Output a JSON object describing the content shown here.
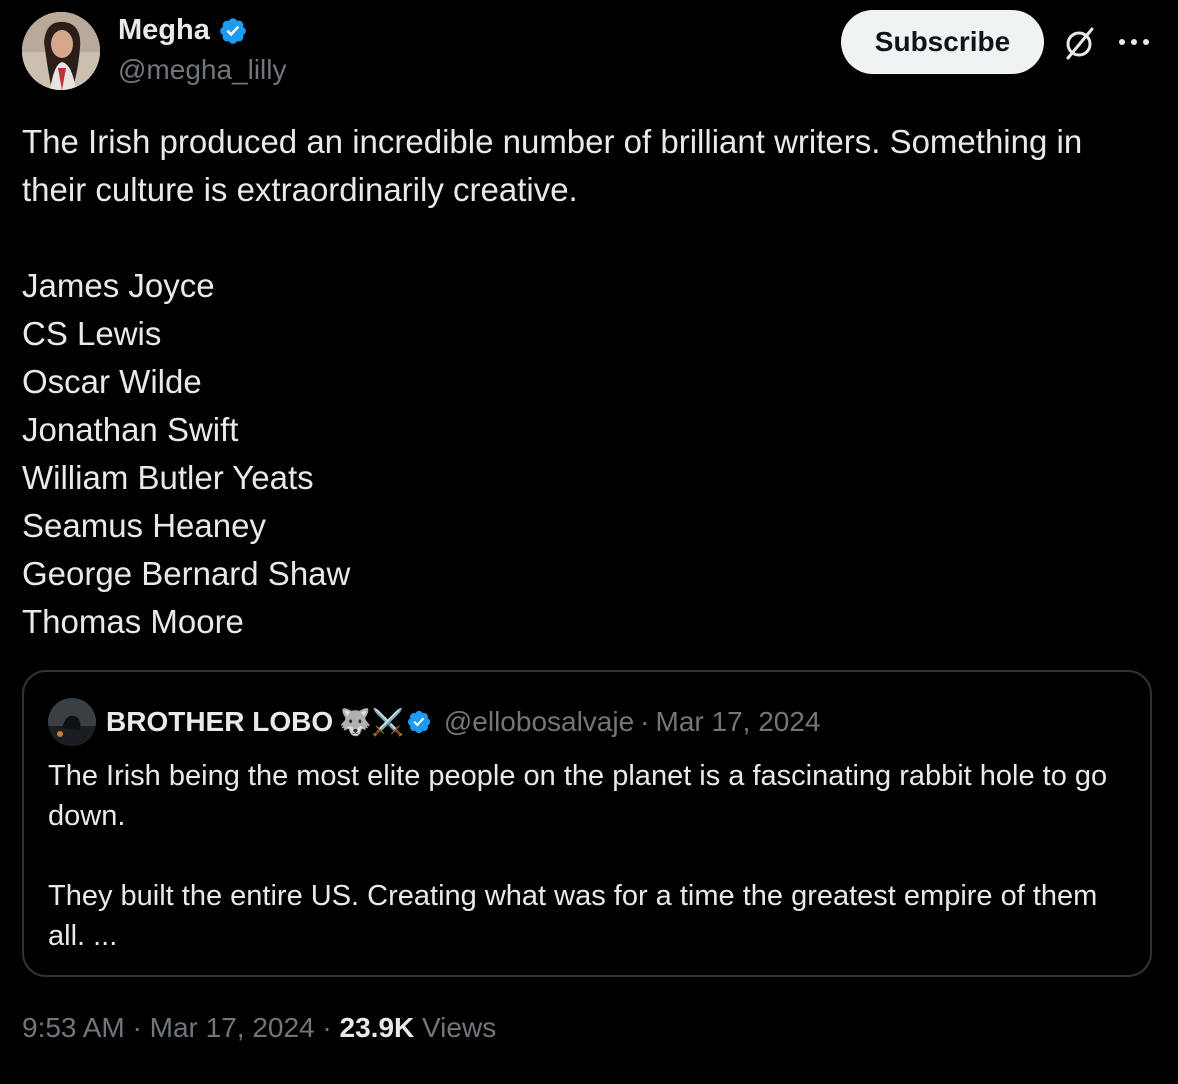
{
  "author": {
    "name": "Megha",
    "handle": "@megha_lilly"
  },
  "actions": {
    "subscribe_label": "Subscribe",
    "grok_icon": "grok-slash-circle-icon",
    "more_icon": "more-dots-icon"
  },
  "tweet": {
    "intro": "The Irish produced an incredible number of brilliant writers. Something in their culture is extraordinarily creative.",
    "writers": [
      "James Joyce",
      "CS Lewis",
      "Oscar Wilde",
      "Jonathan Swift",
      "William Butler Yeats",
      "Seamus Heaney",
      "George Bernard Shaw",
      "Thomas Moore"
    ]
  },
  "quote": {
    "name": "BROTHER LOBO",
    "emojis": "🐺⚔️",
    "handle": "@ellobosalvaje",
    "separator": "·",
    "date": "Mar 17, 2024",
    "paragraph1": "The Irish being the most elite people on the planet is a fascinating rabbit hole to go down.",
    "paragraph2": "They built the entire US. Creating what was for a time the greatest empire of them all. ..."
  },
  "meta": {
    "time": "9:53 AM",
    "separator": "·",
    "date": "Mar 17, 2024",
    "views_count": "23.9K",
    "views_label": "Views"
  },
  "colors": {
    "background": "#000000",
    "text_primary": "#e7e9ea",
    "text_secondary": "#71767b",
    "verified_blue": "#1d9bf0",
    "border": "#2f3336",
    "subscribe_bg": "#eff3f4"
  }
}
